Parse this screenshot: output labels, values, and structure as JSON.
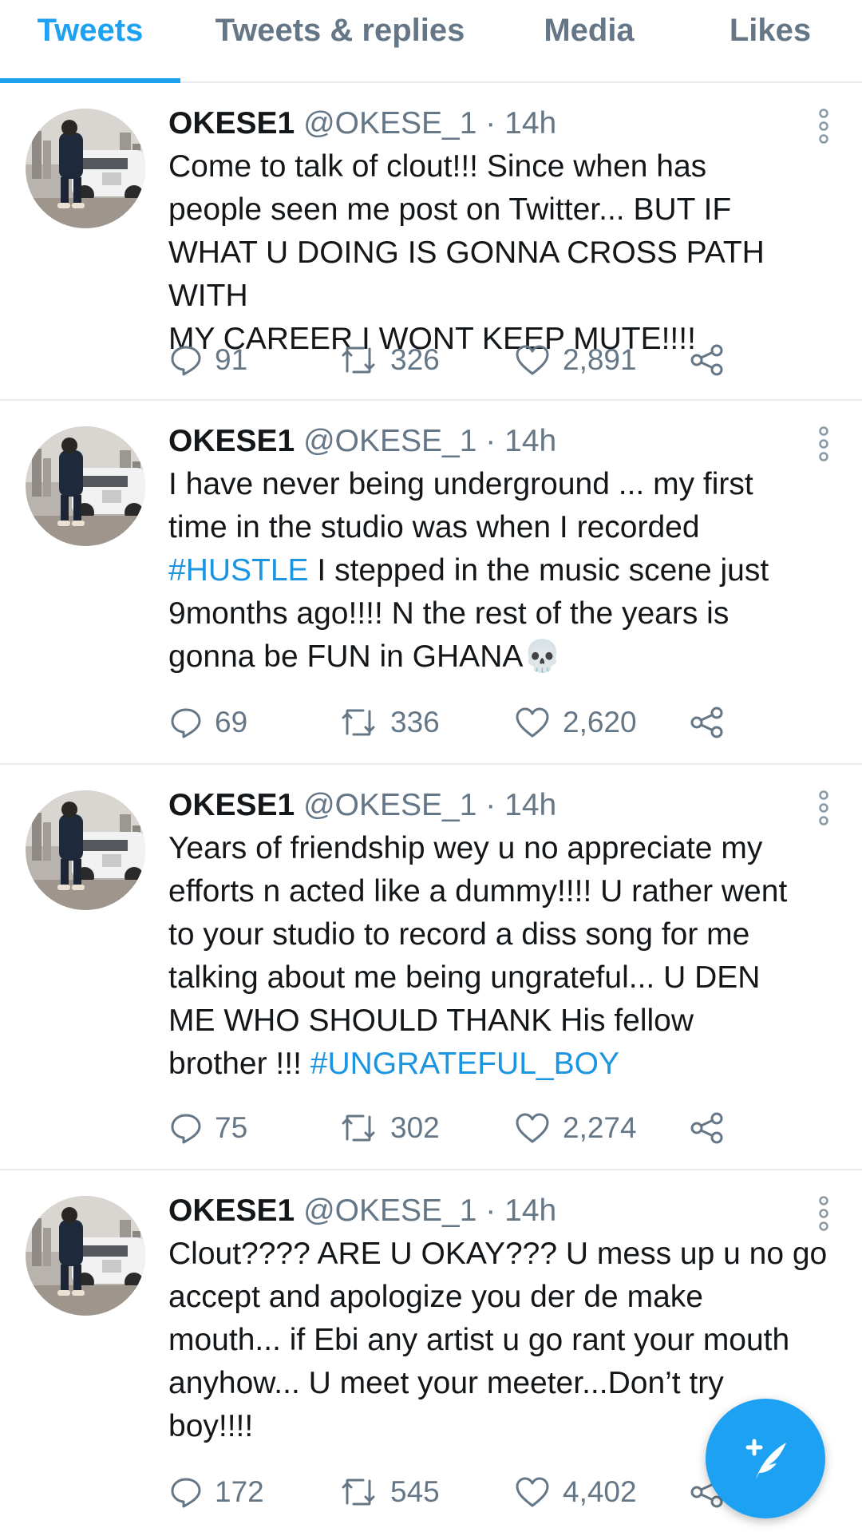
{
  "tabs": [
    {
      "label": "Tweets",
      "active": true
    },
    {
      "label": "Tweets & replies",
      "active": false
    },
    {
      "label": "Media",
      "active": false
    },
    {
      "label": "Likes",
      "active": false
    }
  ],
  "tweets": [
    {
      "name": "OKESE1",
      "handle": "@OKESE_1",
      "separator": "·",
      "time": "14h",
      "text_lines": [
        "Come to talk of clout!!! Since when has",
        "people seen me post on Twitter... BUT IF",
        "WHAT U DOING IS GONNA CROSS PATH WITH",
        "MY CAREER I WONT KEEP MUTE!!!!"
      ],
      "replies": "91",
      "retweets": "326",
      "likes": "2,891"
    },
    {
      "name": "OKESE1",
      "handle": "@OKESE_1",
      "separator": "·",
      "time": "14h",
      "text_lines": [
        "I have never being underground ... my first",
        "time in the studio was when I recorded",
        "I stepped in the music scene just",
        "9months ago!!!! N the rest of the years is",
        "gonna be FUN in GHANA"
      ],
      "hashtag": "#HUSTLE",
      "emoji": "💀",
      "replies": "69",
      "retweets": "336",
      "likes": "2,620"
    },
    {
      "name": "OKESE1",
      "handle": "@OKESE_1",
      "separator": "·",
      "time": "14h",
      "text_lines": [
        "Years of friendship wey u no appreciate my",
        "efforts n acted like a dummy!!!! U rather went",
        "to your studio to record a diss song for me",
        "talking about me being ungrateful... U DEN",
        "ME WHO SHOULD THANK His fellow",
        "brother !!!"
      ],
      "hashtag": "#UNGRATEFUL_BOY",
      "replies": "75",
      "retweets": "302",
      "likes": "2,274"
    },
    {
      "name": "OKESE1",
      "handle": "@OKESE_1",
      "separator": "·",
      "time": "14h",
      "text_lines": [
        "Clout???? ARE U OKAY??? U mess up u no go",
        "accept and apologize you der de make",
        "mouth... if Ebi any artist u go rant your mouth",
        "anyhow... U meet your meeter...Don’t try",
        "boy!!!!"
      ],
      "replies": "172",
      "retweets": "545",
      "likes": "4,402"
    }
  ],
  "colors": {
    "accent": "#1da1f2",
    "hashtag": "#1b95e0",
    "secondary_text": "#657786",
    "divider": "#e6ecf0"
  },
  "icons": {
    "reply": "reply-icon",
    "retweet": "retweet-icon",
    "like": "heart-icon",
    "share": "share-icon",
    "more": "more-vertical-icon",
    "compose": "compose-tweet-icon"
  }
}
